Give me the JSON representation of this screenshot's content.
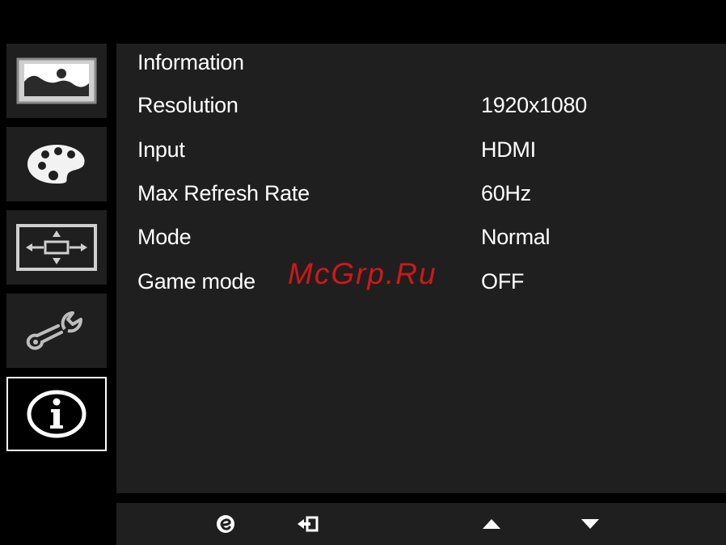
{
  "sidebar": {
    "items": [
      {
        "name": "picture",
        "icon": "picture-icon"
      },
      {
        "name": "color",
        "icon": "palette-icon"
      },
      {
        "name": "osd",
        "icon": "osd-position-icon"
      },
      {
        "name": "setup",
        "icon": "wrench-icon"
      },
      {
        "name": "information",
        "icon": "info-icon",
        "active": true
      }
    ]
  },
  "panel": {
    "title": "Information",
    "rows": [
      {
        "label": "Resolution",
        "value": "1920x1080"
      },
      {
        "label": "Input",
        "value": "HDMI"
      },
      {
        "label": "Max Refresh Rate",
        "value": "60Hz"
      },
      {
        "label": "Mode",
        "value": "Normal"
      },
      {
        "label": "Game mode",
        "value": "OFF"
      }
    ]
  },
  "watermark": "McGrp.Ru",
  "bottom_bar": {
    "buttons": [
      {
        "icon": "e-key-icon"
      },
      {
        "icon": "exit-icon"
      },
      {
        "icon": "arrow-up-icon"
      },
      {
        "icon": "arrow-down-icon"
      }
    ]
  },
  "colors": {
    "background": "#000000",
    "panel": "#1f1f1f",
    "text": "#ffffff",
    "watermark": "#d01818"
  }
}
